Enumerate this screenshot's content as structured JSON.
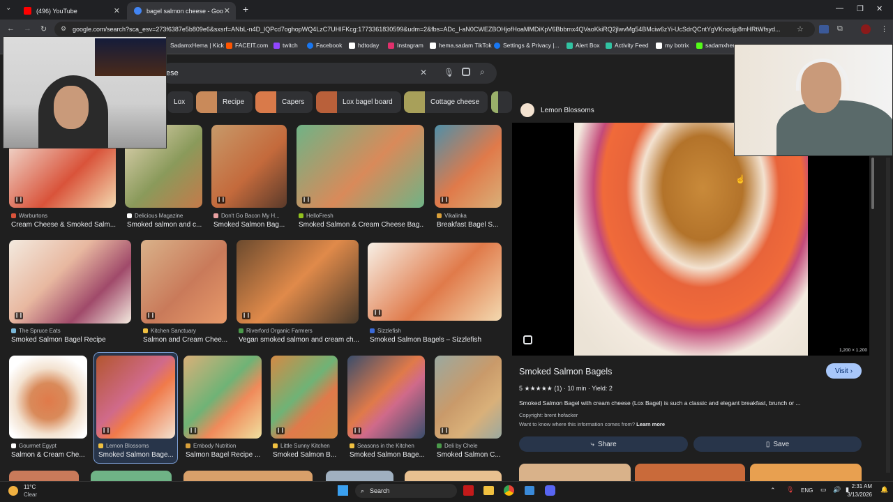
{
  "browser": {
    "tabs": [
      {
        "label": "(496) YouTube",
        "favicon_color": "#ff0000"
      },
      {
        "label": "bagel salmon cheese - Google",
        "favicon_color": "#4285f4"
      }
    ],
    "new_tab": "+",
    "url": "google.com/search?sca_esv=273f6387e5b809e6&sxsrf=ANbL-n4D_lQPcd7oghopWQ4LzC7UHIFKcg:1773361830599&udm=2&fbs=ADc_l-aN0CWEZBOHjofHoaMMDiKpV6Bbbmx4QVaoKkiRQ2jlwvMg54BMciw6zYi-UcSdrQCntYgVKnodjp8mHRtWfsyd...",
    "bookmarks": [
      {
        "label": "SadamxHema | Kick",
        "color": "#53fc18"
      },
      {
        "label": "FACEIT.com",
        "color": "#ff5500"
      },
      {
        "label": "twitch",
        "color": "#9146ff"
      },
      {
        "label": "Facebook",
        "color": "#1877f2"
      },
      {
        "label": "hdtoday",
        "color": "#ffffff"
      },
      {
        "label": "Instagram",
        "color": "#e1306c"
      },
      {
        "label": "hema.sadam TikTok",
        "color": "#ffffff"
      },
      {
        "label": "Settings & Privacy |...",
        "color": "#1877f2"
      },
      {
        "label": "Alert Box",
        "color": "#31c3a2"
      },
      {
        "label": "Activity Feed",
        "color": "#31c3a2"
      },
      {
        "label": "my botrix",
        "color": "#ffffff"
      },
      {
        "label": "sadamxher",
        "color": "#53fc18"
      }
    ]
  },
  "search": {
    "query": "ese",
    "chips": [
      "Lox",
      "Recipe",
      "Capers",
      "Lox bagel board",
      "Cottage cheese"
    ]
  },
  "results": [
    {
      "source": "Warburtons",
      "title": "Cream Cheese & Smoked Salm...",
      "color": "#d9533a"
    },
    {
      "source": "Delicious Magazine",
      "title": "Smoked salmon and c...",
      "color": "#8a9a5b"
    },
    {
      "source": "Don't Go Bacon My H...",
      "title": "Smoked Salmon Bag...",
      "color": "#c46a3c"
    },
    {
      "source": "HelloFresh",
      "title": "Smoked Salmon & Cream Cheese Bag...",
      "color": "#6fb386"
    },
    {
      "source": "Vikalinka",
      "title": "Breakfast Bagel S...",
      "color": "#4f8fa8"
    },
    {
      "source": "The Spruce Eats",
      "title": "Smoked Salmon Bagel Recipe",
      "color": "#e8b8a0"
    },
    {
      "source": "Kitchen Sanctuary",
      "title": "Salmon and Cream Chee...",
      "color": "#c97a5a"
    },
    {
      "source": "Riverford Organic Farmers",
      "title": "Vegan smoked salmon and cream ch...",
      "color": "#6b4a2e"
    },
    {
      "source": "Sizzlefish",
      "title": "Smoked Salmon Bagels – Sizzlefish",
      "color": "#e07a4a"
    },
    {
      "source": "Gourmet Egypt",
      "title": "Salmon & Cream Che...",
      "color": "#f3e2d0"
    },
    {
      "source": "Lemon Blossoms",
      "title": "Smoked Salmon Bage...",
      "color": "#b3562f"
    },
    {
      "source": "Embody Nutrition",
      "title": "Salmon Bagel Recipe ...",
      "color": "#d9b079"
    },
    {
      "source": "Little Sunny Kitchen",
      "title": "Smoked Salmon B...",
      "color": "#d48a45"
    },
    {
      "source": "Seasons in the Kitchen",
      "title": "Smoked Salmon Bage...",
      "color": "#3a4d6b"
    },
    {
      "source": "Deli by Chele",
      "title": "Smoked Salmon C...",
      "color": "#9aa9a0"
    }
  ],
  "panel": {
    "site": "Lemon Blossoms",
    "image_size": "1,200 × 1,200",
    "title": "Smoked Salmon Bagels",
    "visit": "Visit",
    "rating": "5 ★★★★★ (1) · 10 min · Yield: 2",
    "description": "Smoked Salmon Bagel with cream cheese (Lox Bagel) is such a classic and elegant breakfast, brunch or ...",
    "copyright": "Copyright: brent hofacker",
    "info_prompt": "Want to know where this information comes from?",
    "learn_more": "Learn more",
    "share": "Share",
    "save": "Save"
  },
  "taskbar": {
    "weather_temp": "11°C",
    "weather_desc": "Clear",
    "search": "Search",
    "lang": "ENG",
    "time": "2:31 AM",
    "date": "3/13/2026"
  },
  "colors": {
    "accent_blue": "#a8c7fa",
    "panel_button": "#28354a"
  }
}
